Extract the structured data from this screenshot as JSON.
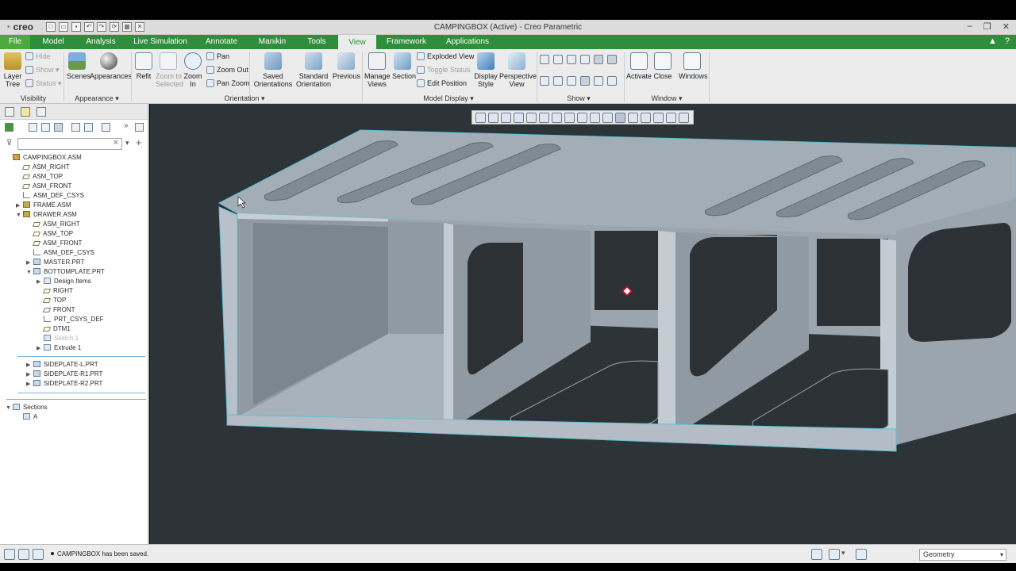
{
  "window": {
    "title": "CAMPINGBOX (Active) - Creo Parametric",
    "logo": "creo"
  },
  "tabs": [
    {
      "label": "File"
    },
    {
      "label": "Model"
    },
    {
      "label": "Analysis"
    },
    {
      "label": "Live Simulation"
    },
    {
      "label": "Annotate"
    },
    {
      "label": "Manikin"
    },
    {
      "label": "Tools"
    },
    {
      "label": "View"
    },
    {
      "label": "Framework"
    },
    {
      "label": "Applications"
    }
  ],
  "ribbon": {
    "visibility": {
      "layer_tree": "Layer\nTree",
      "hide": "Hide",
      "show": "Show",
      "status": "Status",
      "group": "Visibility"
    },
    "appearance": {
      "scenes": "Scenes",
      "appearances": "Appearances",
      "group": "Appearance"
    },
    "orientation": {
      "refit": "Refit",
      "zoom_to_selected": "Zoom to\nSelected",
      "zoom_in": "Zoom\nIn",
      "pan": "Pan",
      "zoom_out": "Zoom Out",
      "pan_zoom": "Pan Zoom",
      "saved_orientations": "Saved\nOrientations",
      "standard_orientation": "Standard\nOrientation",
      "previous": "Previous",
      "group": "Orientation"
    },
    "model_display": {
      "manage_views": "Manage\nViews",
      "section": "Section",
      "exploded_view": "Exploded View",
      "toggle_status": "Toggle Status",
      "edit_position": "Edit Position",
      "display_style": "Display\nStyle",
      "perspective_view": "Perspective\nView",
      "group": "Model Display"
    },
    "show": {
      "group": "Show"
    },
    "window": {
      "activate": "Activate",
      "close": "Close",
      "windows": "Windows",
      "group": "Window"
    }
  },
  "tree": [
    {
      "label": "CAMPINGBOX.ASM",
      "icon": "asm-icon",
      "depth": 0,
      "arrow": ""
    },
    {
      "label": "ASM_RIGHT",
      "icon": "plane-icon",
      "depth": 1,
      "arrow": ""
    },
    {
      "label": "ASM_TOP",
      "icon": "plane-icon",
      "depth": 1,
      "arrow": ""
    },
    {
      "label": "ASM_FRONT",
      "icon": "plane-icon",
      "depth": 1,
      "arrow": ""
    },
    {
      "label": "ASM_DEF_CSYS",
      "icon": "csys-icon",
      "depth": 1,
      "arrow": ""
    },
    {
      "label": "FRAME.ASM",
      "icon": "asm-icon",
      "depth": 1,
      "arrow": "▶"
    },
    {
      "label": "DRAWER.ASM",
      "icon": "asm-icon",
      "depth": 1,
      "arrow": "▼"
    },
    {
      "label": "ASM_RIGHT",
      "icon": "plane-icon",
      "depth": 2,
      "arrow": ""
    },
    {
      "label": "ASM_TOP",
      "icon": "plane-icon",
      "depth": 2,
      "arrow": ""
    },
    {
      "label": "ASM_FRONT",
      "icon": "plane-icon",
      "depth": 2,
      "arrow": ""
    },
    {
      "label": "ASM_DEF_CSYS",
      "icon": "csys-icon",
      "depth": 2,
      "arrow": ""
    },
    {
      "label": "MASTER.PRT",
      "icon": "prt-icon",
      "depth": 2,
      "arrow": "▶"
    },
    {
      "label": "BOTTOMPLATE.PRT",
      "icon": "prt-icon",
      "depth": 2,
      "arrow": "▼"
    },
    {
      "label": "Design Items",
      "icon": "feat-icon",
      "depth": 3,
      "arrow": "▶"
    },
    {
      "label": "RIGHT",
      "icon": "plane-icon",
      "depth": 3,
      "arrow": ""
    },
    {
      "label": "TOP",
      "icon": "plane-icon",
      "depth": 3,
      "arrow": ""
    },
    {
      "label": "FRONT",
      "icon": "plane-icon",
      "depth": 3,
      "arrow": ""
    },
    {
      "label": "PRT_CSYS_DEF",
      "icon": "csys-icon",
      "depth": 3,
      "arrow": ""
    },
    {
      "label": "DTM1",
      "icon": "plane-icon",
      "depth": 3,
      "arrow": ""
    },
    {
      "label": "Sketch 1",
      "icon": "feat-icon",
      "depth": 3,
      "arrow": "",
      "dim": true
    },
    {
      "label": "Extrude 1",
      "icon": "feat-icon",
      "depth": 3,
      "arrow": "▶"
    },
    {
      "label": "SIDEPLATE-L.PRT",
      "icon": "prt-icon",
      "depth": 2,
      "arrow": "▶"
    },
    {
      "label": "SIDEPLATE-R1.PRT",
      "icon": "prt-icon",
      "depth": 2,
      "arrow": "▶"
    },
    {
      "label": "SIDEPLATE-R2.PRT",
      "icon": "prt-icon",
      "depth": 2,
      "arrow": "▶"
    },
    {
      "label": "Sections",
      "icon": "sec-icon",
      "depth": 0,
      "arrow": "▼"
    },
    {
      "label": "A",
      "icon": "sec-icon",
      "depth": 1,
      "arrow": ""
    }
  ],
  "status": {
    "message": "CAMPINGBOX has been saved.",
    "filter": "Geometry"
  },
  "colors": {
    "accent_green": "#2f8e3b",
    "file_tab": "#4aaa3c",
    "viewport_bg": "#2d3438",
    "model_face": "#a9b3bc"
  }
}
